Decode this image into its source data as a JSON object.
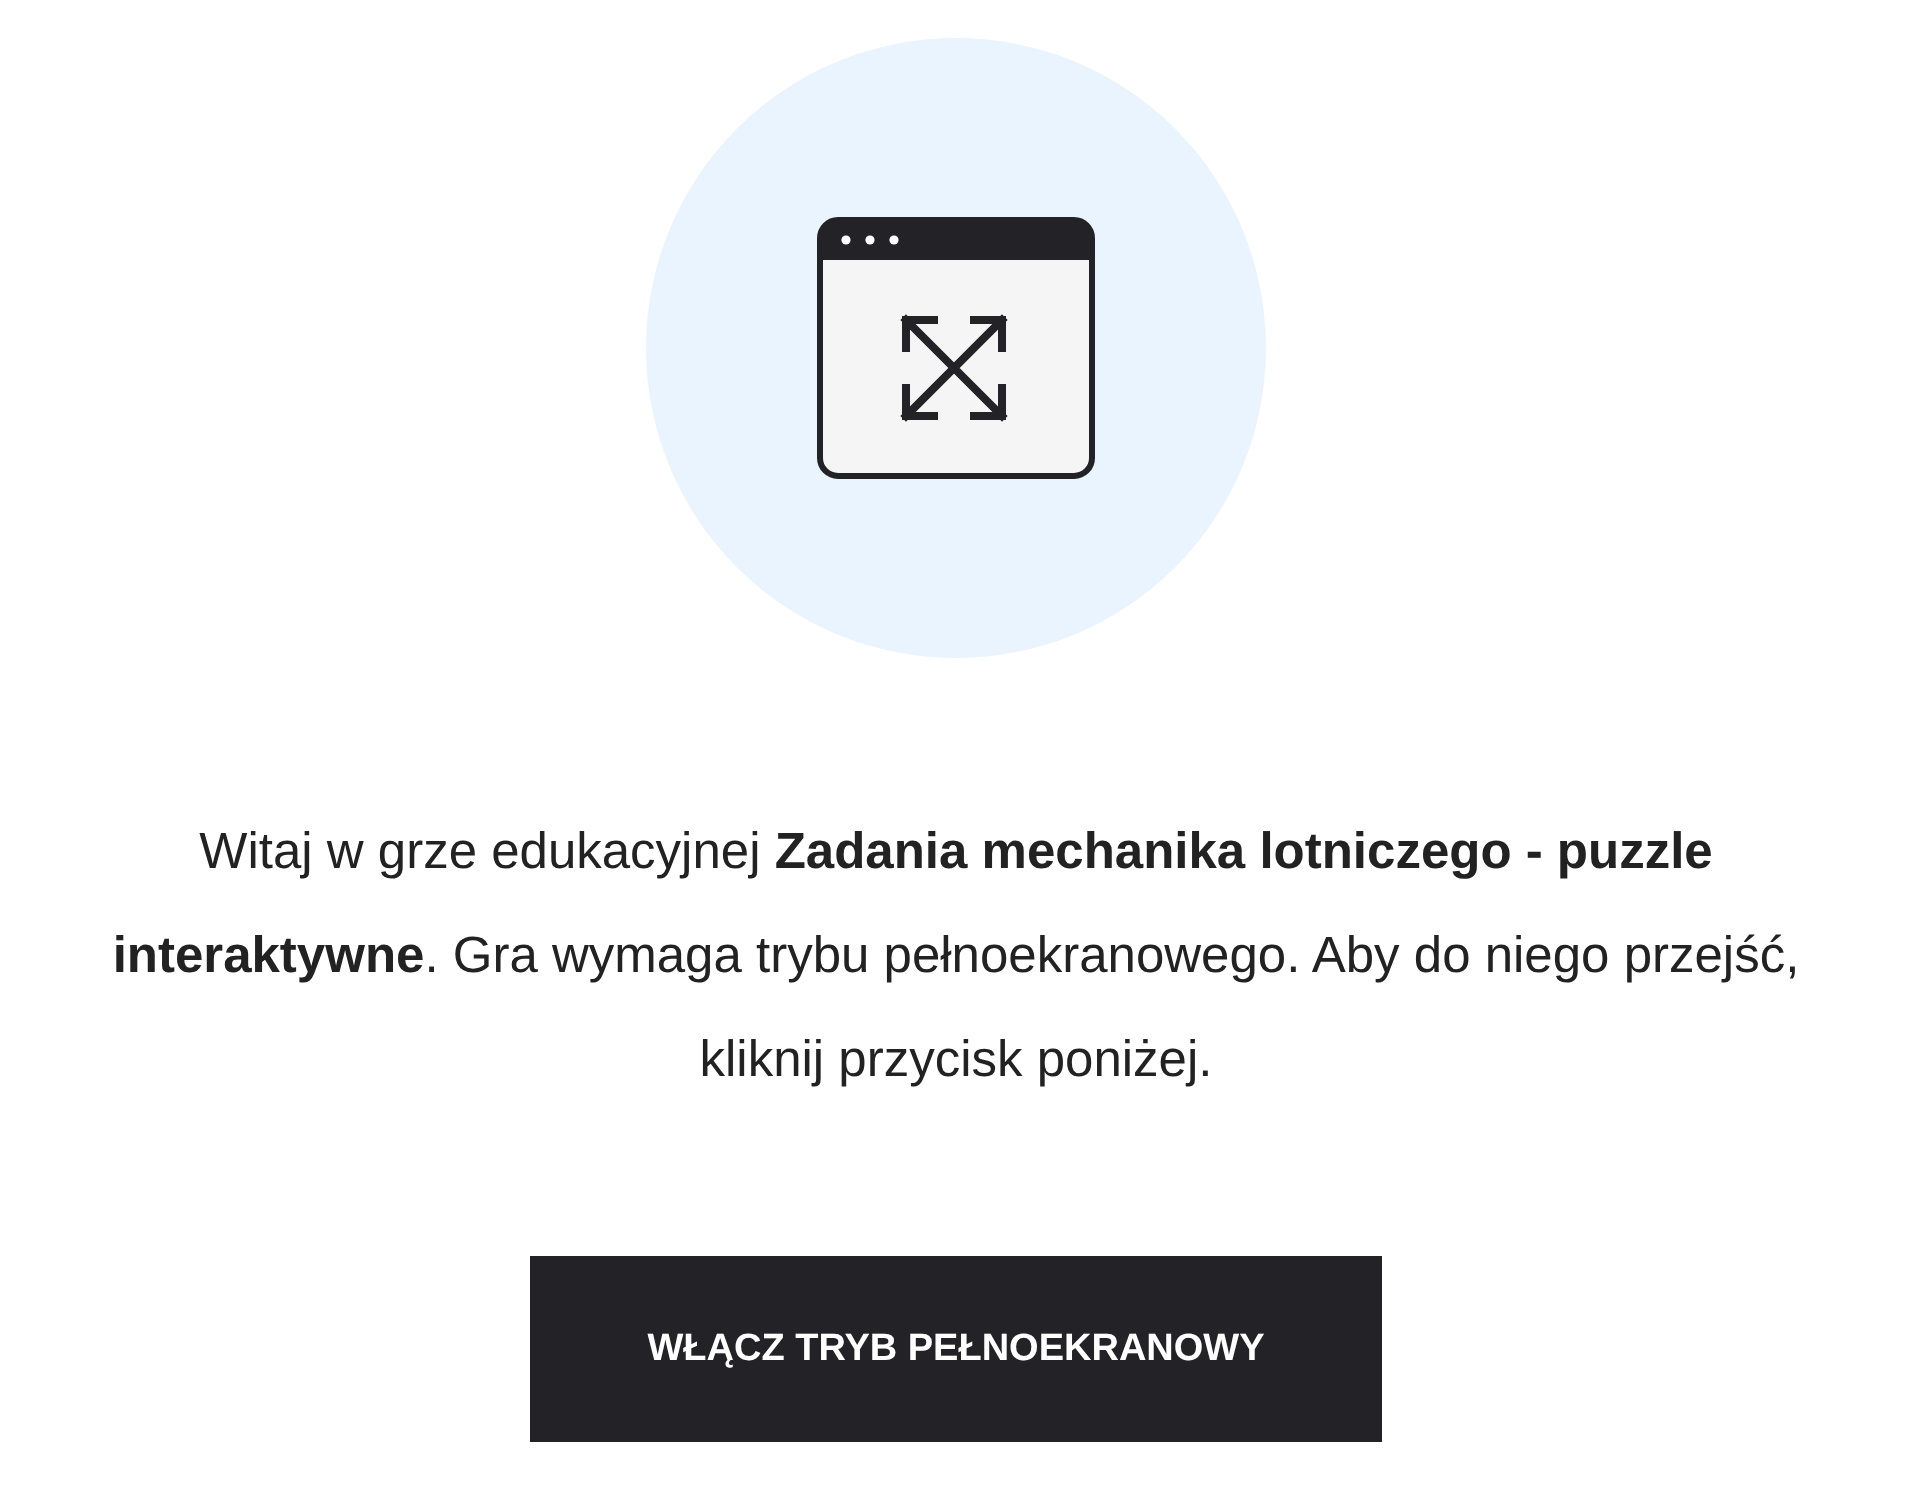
{
  "intro": {
    "text": "Witaj w grze edukacyjnej **Zadania mechanika lotniczego - puzzle interaktywne**. Gra wymaga trybu pełnoekranowego. Aby do niego przejść, kliknij przycisk poniżej."
  },
  "button": {
    "label": "WŁĄCZ TRYB PEŁNOEKRANOWY"
  }
}
